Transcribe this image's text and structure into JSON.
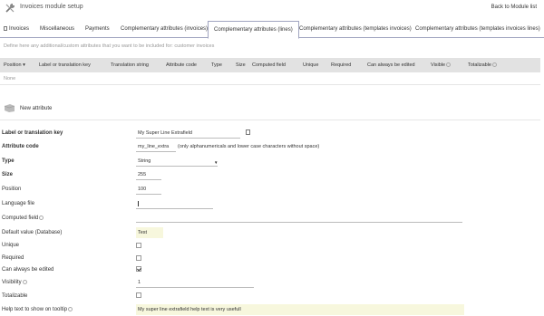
{
  "header": {
    "title": "Invoices module setup",
    "back_link": "Back to Module list"
  },
  "tabs": [
    {
      "label": "Invoices"
    },
    {
      "label": "Miscellaneous"
    },
    {
      "label": "Payments"
    },
    {
      "label": "Complementary attributes (invoices)"
    },
    {
      "label": "Complementary attributes (lines)",
      "active": true
    },
    {
      "label": "Complementary attributes (templates invoices)"
    },
    {
      "label": "Complementary attributes (templates invoices lines)"
    }
  ],
  "info_text": "Define here any additional/custom attributes that you want to be included for: customer invoices",
  "table": {
    "columns": [
      "Position",
      "Label or translation key",
      "Translation string",
      "Attribute code",
      "Type",
      "Size",
      "Computed field",
      "Unique",
      "Required",
      "Can always be edited",
      "Visible",
      "Totalizable"
    ],
    "empty_text": "None"
  },
  "new_attribute_label": "New attribute",
  "form": {
    "label_key": {
      "label": "Label or translation key",
      "value": "My Super Line Extrafield"
    },
    "attribute_code": {
      "label": "Attribute code",
      "value": "my_line_extra",
      "hint": "(only alphanumericals and lower case characters without space)"
    },
    "type": {
      "label": "Type",
      "value": "String"
    },
    "size": {
      "label": "Size",
      "value": "255"
    },
    "position": {
      "label": "Position",
      "value": "100"
    },
    "language_file": {
      "label": "Language file",
      "value": ""
    },
    "computed_field": {
      "label": "Computed field",
      "value": ""
    },
    "default_value": {
      "label": "Default value (Database)",
      "value": "Test"
    },
    "unique": {
      "label": "Unique",
      "checked": false
    },
    "required": {
      "label": "Required",
      "checked": false
    },
    "always_editable": {
      "label": "Can always be edited",
      "checked": true
    },
    "visibility": {
      "label": "Visibility",
      "value": "1"
    },
    "totalizable": {
      "label": "Totalizable",
      "checked": false
    },
    "help_text": {
      "label": "Help text to show on tooltip",
      "value": "My super line extrafield help text is very usefull"
    }
  },
  "colors": {
    "tab_border": "#a0a4c0",
    "table_header": "#e2e2e2",
    "highlight": "#f7f7dd"
  }
}
